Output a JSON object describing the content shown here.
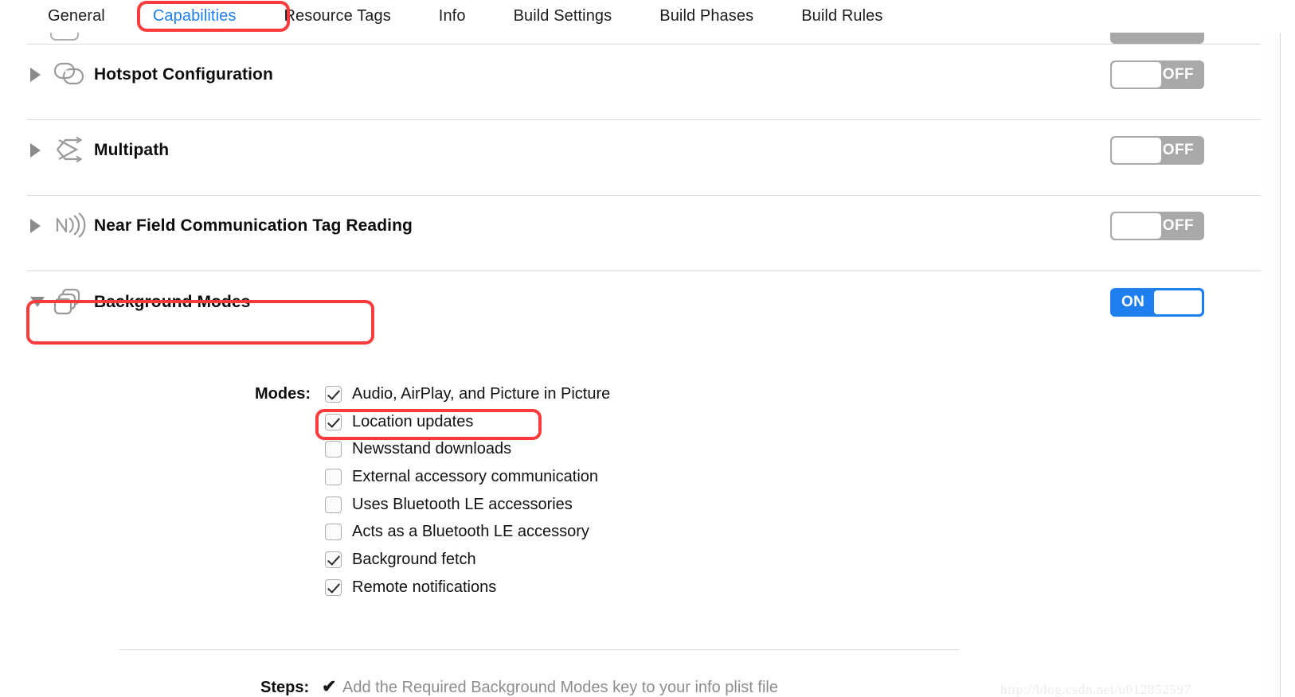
{
  "tabs": [
    {
      "label": "General",
      "active": false
    },
    {
      "label": "Capabilities",
      "active": true
    },
    {
      "label": "Resource Tags",
      "active": false
    },
    {
      "label": "Info",
      "active": false
    },
    {
      "label": "Build Settings",
      "active": false
    },
    {
      "label": "Build Phases",
      "active": false
    },
    {
      "label": "Build Rules",
      "active": false
    }
  ],
  "capabilities": [
    {
      "title": "Hotspot Configuration",
      "icon": "hotspot-configuration-icon",
      "expanded": false,
      "toggle": "OFF"
    },
    {
      "title": "Multipath",
      "icon": "multipath-icon",
      "expanded": false,
      "toggle": "OFF"
    },
    {
      "title": "Near Field Communication Tag Reading",
      "icon": "nfc-tag-reading-icon",
      "expanded": false,
      "toggle": "OFF"
    },
    {
      "title": "Background Modes",
      "icon": "background-modes-icon",
      "expanded": true,
      "toggle": "ON"
    }
  ],
  "background_modes": {
    "modes_label": "Modes:",
    "items": [
      {
        "label": "Audio, AirPlay, and Picture in Picture",
        "checked": true
      },
      {
        "label": "Location updates",
        "checked": true
      },
      {
        "label": "Newsstand downloads",
        "checked": false
      },
      {
        "label": "External accessory communication",
        "checked": false
      },
      {
        "label": "Uses Bluetooth LE accessories",
        "checked": false
      },
      {
        "label": "Acts as a Bluetooth LE accessory",
        "checked": false
      },
      {
        "label": "Background fetch",
        "checked": true
      },
      {
        "label": "Remote notifications",
        "checked": true
      }
    ],
    "steps_label": "Steps:",
    "steps_check": "✔",
    "steps_text": "Add the Required Background Modes key to your info plist file"
  },
  "watermark": "http://blog.csdn.net/u012852597",
  "colors": {
    "accent_blue": "#1f7ef0",
    "annotation_red": "#fb3b3b",
    "toggle_off_gray": "#a9a9a9",
    "divider_gray": "#d9d9d9",
    "muted_text": "#8d8d8d"
  }
}
